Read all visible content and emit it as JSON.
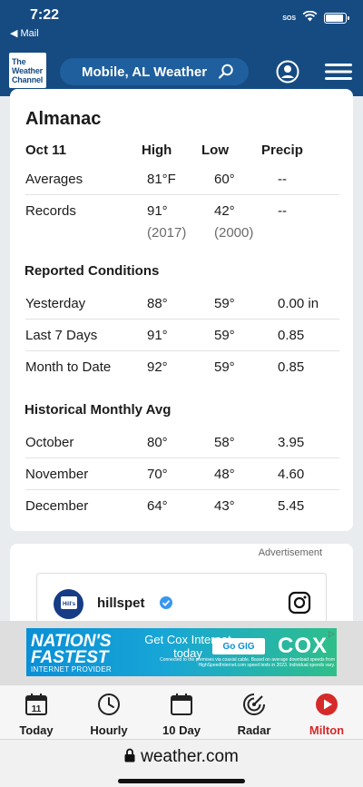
{
  "status": {
    "time": "7:22",
    "back": "◀ Mail",
    "sos": "SOS",
    "battery_level": 0.9
  },
  "header": {
    "logo_lines": [
      "The",
      "Weather",
      "Channel"
    ],
    "location": "Mobile, AL Weather"
  },
  "almanac": {
    "title": "Almanac",
    "headers": {
      "date": "Oct 11",
      "high": "High",
      "low": "Low",
      "precip": "Precip"
    },
    "averages": {
      "label": "Averages",
      "high": "81°F",
      "low": "60°",
      "precip": "--"
    },
    "records": {
      "label": "Records",
      "high": "91°",
      "low": "42°",
      "precip": "--",
      "high_year": "(2017)",
      "low_year": "(2000)"
    },
    "reported_title": "Reported Conditions",
    "reported": [
      {
        "label": "Yesterday",
        "high": "88°",
        "low": "59°",
        "precip": "0.00 in"
      },
      {
        "label": "Last 7 Days",
        "high": "91°",
        "low": "59°",
        "precip": "0.85"
      },
      {
        "label": "Month to Date",
        "high": "92°",
        "low": "59°",
        "precip": "0.85"
      }
    ],
    "historical_title": "Historical Monthly Avg",
    "historical": [
      {
        "label": "October",
        "high": "80°",
        "low": "58°",
        "precip": "3.95"
      },
      {
        "label": "November",
        "high": "70°",
        "low": "48°",
        "precip": "4.60"
      },
      {
        "label": "December",
        "high": "64°",
        "low": "43°",
        "precip": "5.45"
      }
    ]
  },
  "ad": {
    "label": "Advertisement",
    "account": "hillspet",
    "avatar_text": "Hill's"
  },
  "banner": {
    "line1": "NATION'S",
    "line2": "FASTEST",
    "line3": "INTERNET PROVIDER",
    "get": "Get Cox Internet today",
    "button": "Go GIG",
    "small": "Connected to the premises via coaxial cable. Based on average download speeds from HighSpeedInternet.com speed tests in 2023. Individual speeds vary.",
    "brand": "COX"
  },
  "nav": [
    {
      "label": "Today",
      "icon": "calendar-icon",
      "day": "11"
    },
    {
      "label": "Hourly",
      "icon": "clock-icon"
    },
    {
      "label": "10 Day",
      "icon": "calendar-grid-icon"
    },
    {
      "label": "Radar",
      "icon": "radar-icon"
    },
    {
      "label": "Milton",
      "icon": "play-icon",
      "color": "#d62a2a"
    }
  ],
  "url": "weather.com",
  "colors": {
    "header_bg": "#164b82",
    "live_red": "#d62a2a"
  }
}
